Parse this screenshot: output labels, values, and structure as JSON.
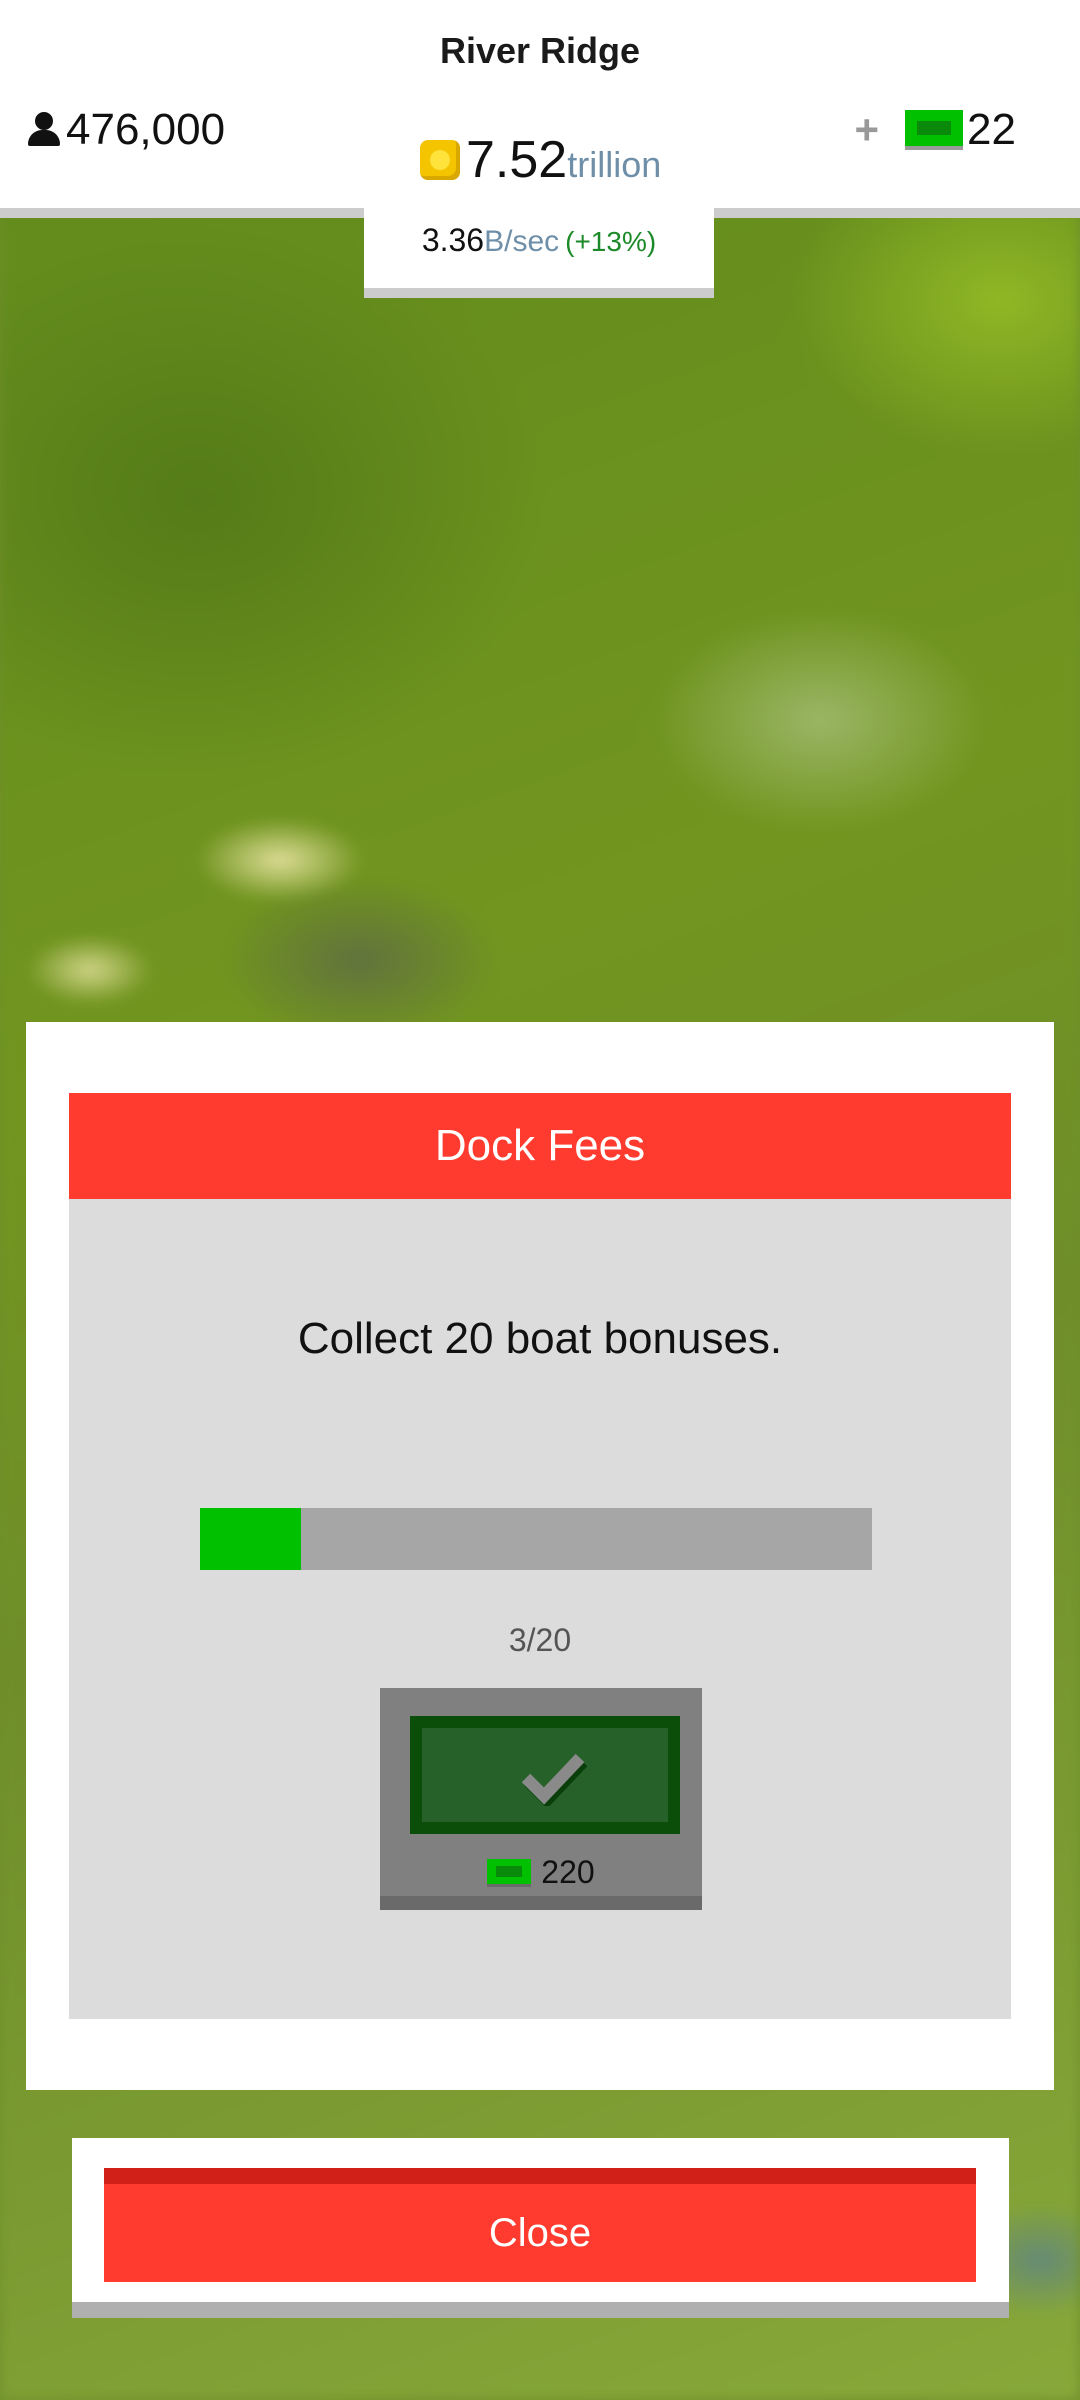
{
  "hud": {
    "town_name": "River Ridge",
    "population": "476,000",
    "coins_value": "7.52",
    "coins_unit": "trillion",
    "rate_value": "3.36",
    "rate_unit": "B/sec",
    "rate_change": "(+13%)",
    "cash_plus": "+",
    "cash_value": "22"
  },
  "dialog": {
    "title": "Dock Fees",
    "task": "Collect 20 boat bonuses.",
    "progress": {
      "current": 3,
      "total": 20,
      "label": "3/20"
    },
    "reward_amount": "220",
    "close_label": "Close"
  },
  "colors": {
    "header_red": "#ff3a2e",
    "progress_green": "#00c000",
    "cash_green": "#00c000"
  }
}
